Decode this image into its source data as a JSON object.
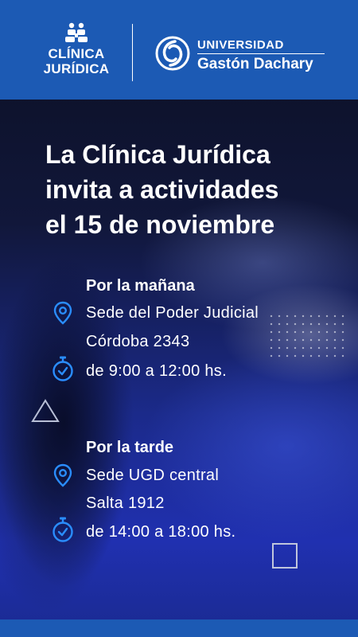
{
  "header": {
    "clinica_line1": "CLÍNICA",
    "clinica_line2": "JURÍDICA",
    "university_line1": "UNIVERSIDAD",
    "university_line2": "Gastón Dachary",
    "colors": {
      "brand_blue": "#1c5ab4",
      "icon_blue": "#2a8dff"
    },
    "icons": [
      "people-icon",
      "ugd-circle-logo"
    ]
  },
  "headline": {
    "line1": "La Clínica Jurídica",
    "line2": "invita a actividades",
    "line3": "el 15 de noviembre"
  },
  "morning": {
    "title": "Por la mañana",
    "place": "Sede del Poder Judicial",
    "address": "Córdoba 2343",
    "time": "de 9:00 a 12:00 hs."
  },
  "afternoon": {
    "title": "Por la tarde",
    "place": "Sede UGD central",
    "address": "Salta 1912",
    "time": "de 14:00 a 18:00 hs."
  }
}
